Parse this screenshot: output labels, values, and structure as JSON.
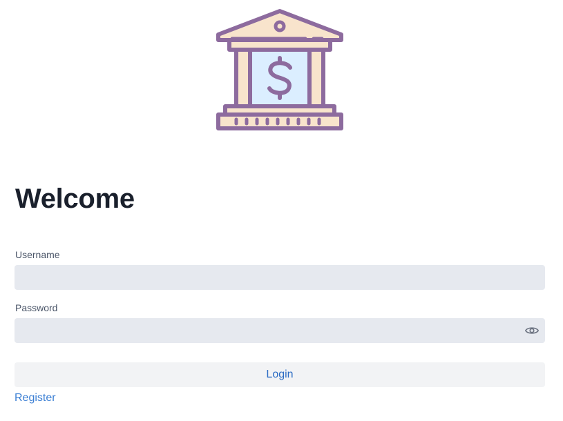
{
  "logo": {
    "icon": "bank-icon"
  },
  "title": "Welcome",
  "username": {
    "label": "Username",
    "value": "",
    "placeholder": ""
  },
  "password": {
    "label": "Password",
    "value": "",
    "placeholder": "",
    "toggle_icon": "eye-icon"
  },
  "login_label": "Login",
  "register_label": "Register",
  "colors": {
    "primary_text": "#1a202c",
    "link": "#3b7fd4",
    "field_bg": "#e6e9ef",
    "button_bg": "#f2f3f5",
    "logo_stroke": "#8d6b9e",
    "logo_fill": "#f8e4cc",
    "logo_window": "#dbeeff"
  }
}
